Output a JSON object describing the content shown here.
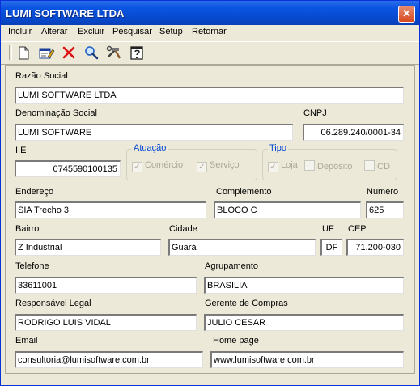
{
  "window": {
    "title": "LUMI SOFTWARE LTDA",
    "close_glyph": "✕"
  },
  "menu": [
    "Incluir",
    "Alterar",
    "Excluir",
    "Pesquisar",
    "Setup",
    "Retornar"
  ],
  "toolbar": {
    "icons": [
      "new-document-icon",
      "edit-form-icon",
      "delete-x-icon",
      "search-magnifier-icon",
      "tools-icon",
      "exit-door-icon"
    ]
  },
  "form": {
    "razao_social": {
      "label": "Razão Social",
      "value": "LUMI SOFTWARE LTDA"
    },
    "denominacao_social": {
      "label": "Denominação Social",
      "value": "LUMI SOFTWARE"
    },
    "cnpj": {
      "label": "CNPJ",
      "value": "06.289.240/0001-34"
    },
    "ie": {
      "label": "I.E",
      "value": "0745590100135"
    },
    "atuacao": {
      "title": "Atuação",
      "options": [
        {
          "label": "Comércio",
          "checked": true
        },
        {
          "label": "Serviço",
          "checked": true
        }
      ]
    },
    "tipo": {
      "title": "Tipo",
      "options": [
        {
          "label": "Loja",
          "checked": true
        },
        {
          "label": "Depósito",
          "checked": false
        },
        {
          "label": "CD",
          "checked": false
        }
      ]
    },
    "endereco": {
      "label": "Endereço",
      "value": "SIA Trecho 3"
    },
    "complemento": {
      "label": "Complemento",
      "value": "BLOCO C"
    },
    "numero": {
      "label": "Numero",
      "value": "625"
    },
    "bairro": {
      "label": "Bairro",
      "value": "Z Industrial"
    },
    "cidade": {
      "label": "Cidade",
      "value": "Guará"
    },
    "uf": {
      "label": "UF",
      "value": "DF"
    },
    "cep": {
      "label": "CEP",
      "value": "71.200-030"
    },
    "telefone": {
      "label": "Telefone",
      "value": "33611001"
    },
    "agrupamento": {
      "label": "Agrupamento",
      "value": "BRASILIA"
    },
    "responsavel": {
      "label": "Responsável Legal",
      "value": "RODRIGO LUIS VIDAL"
    },
    "gerente": {
      "label": "Gerente de Compras",
      "value": "JULIO CESAR"
    },
    "email": {
      "label": "Email",
      "value": "consultoria@lumisoftware.com.br"
    },
    "homepage": {
      "label": "Home page",
      "value": "www.lumisoftware.com.br"
    }
  },
  "colors": {
    "title_bar": "#0a54e3",
    "group_title": "#0046d5",
    "window_bg": "#ece9d8"
  }
}
